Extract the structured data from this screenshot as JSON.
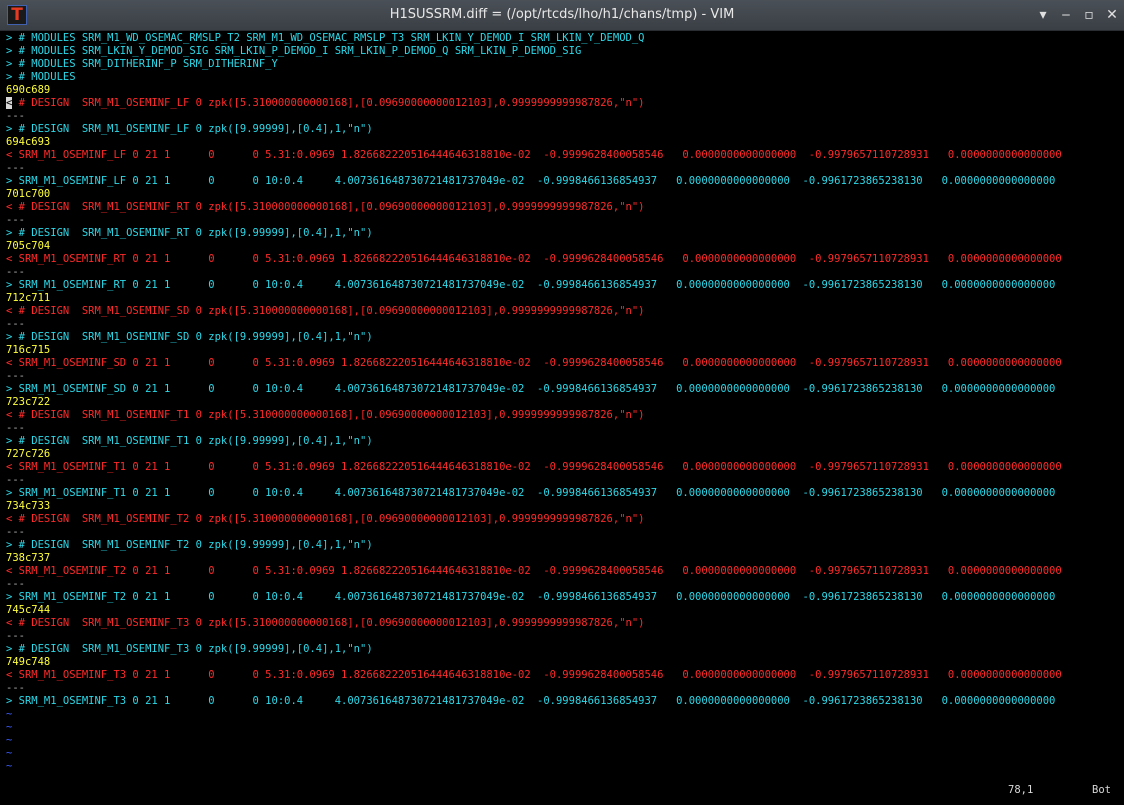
{
  "window": {
    "title": "H1SUSSRM.diff = (/opt/rtcds/lho/h1/chans/tmp) - VIM",
    "icon_glyph": "T",
    "buttons": {
      "shade": "▾",
      "minimize": "‒",
      "maximize": "▫",
      "close": "✕"
    }
  },
  "colors": {
    "added": "#2cd8e8",
    "removed": "#ff2a2a",
    "hunk": "#ffff3c",
    "separator": "#b0b0b0",
    "tilde": "#3a5cff",
    "background": "#000000"
  },
  "lines": [
    {
      "kind": "added",
      "text": "> # MODULES SRM_M1_WD_OSEMAC_RMSLP_T2 SRM_M1_WD_OSEMAC_RMSLP_T3 SRM_LKIN_Y_DEMOD_I SRM_LKIN_Y_DEMOD_Q"
    },
    {
      "kind": "added",
      "text": "> # MODULES SRM_LKIN_Y_DEMOD_SIG SRM_LKIN_P_DEMOD_I SRM_LKIN_P_DEMOD_Q SRM_LKIN_P_DEMOD_SIG"
    },
    {
      "kind": "added",
      "text": "> # MODULES SRM_DITHERINF_P SRM_DITHERINF_Y"
    },
    {
      "kind": "added",
      "text": "> # MODULES"
    },
    {
      "kind": "hunk",
      "text": "690c689"
    },
    {
      "kind": "removed",
      "cursor": "<",
      "text": " # DESIGN  SRM_M1_OSEMINF_LF 0 zpk([5.310000000000168],[0.09690000000012103],0.9999999999987826,\"n\")"
    },
    {
      "kind": "sep",
      "text": "---"
    },
    {
      "kind": "added",
      "text": "> # DESIGN  SRM_M1_OSEMINF_LF 0 zpk([9.99999],[0.4],1,\"n\")"
    },
    {
      "kind": "hunk",
      "text": "694c693"
    },
    {
      "kind": "removed",
      "text": "< SRM_M1_OSEMINF_LF 0 21 1      0      0 5.31:0.0969 1.826682220516444646318810e-02  -0.9999628400058546   0.0000000000000000  -0.9979657110728931   0.0000000000000000"
    },
    {
      "kind": "sep",
      "text": "---"
    },
    {
      "kind": "added",
      "text": "> SRM_M1_OSEMINF_LF 0 21 1      0      0 10:0.4     4.007361648730721481737049e-02  -0.9998466136854937   0.0000000000000000  -0.9961723865238130   0.0000000000000000"
    },
    {
      "kind": "hunk",
      "text": "701c700"
    },
    {
      "kind": "removed",
      "text": "< # DESIGN  SRM_M1_OSEMINF_RT 0 zpk([5.310000000000168],[0.09690000000012103],0.9999999999987826,\"n\")"
    },
    {
      "kind": "sep",
      "text": "---"
    },
    {
      "kind": "added",
      "text": "> # DESIGN  SRM_M1_OSEMINF_RT 0 zpk([9.99999],[0.4],1,\"n\")"
    },
    {
      "kind": "hunk",
      "text": "705c704"
    },
    {
      "kind": "removed",
      "text": "< SRM_M1_OSEMINF_RT 0 21 1      0      0 5.31:0.0969 1.826682220516444646318810e-02  -0.9999628400058546   0.0000000000000000  -0.9979657110728931   0.0000000000000000"
    },
    {
      "kind": "sep",
      "text": "---"
    },
    {
      "kind": "added",
      "text": "> SRM_M1_OSEMINF_RT 0 21 1      0      0 10:0.4     4.007361648730721481737049e-02  -0.9998466136854937   0.0000000000000000  -0.9961723865238130   0.0000000000000000"
    },
    {
      "kind": "hunk",
      "text": "712c711"
    },
    {
      "kind": "removed",
      "text": "< # DESIGN  SRM_M1_OSEMINF_SD 0 zpk([5.310000000000168],[0.09690000000012103],0.9999999999987826,\"n\")"
    },
    {
      "kind": "sep",
      "text": "---"
    },
    {
      "kind": "added",
      "text": "> # DESIGN  SRM_M1_OSEMINF_SD 0 zpk([9.99999],[0.4],1,\"n\")"
    },
    {
      "kind": "hunk",
      "text": "716c715"
    },
    {
      "kind": "removed",
      "text": "< SRM_M1_OSEMINF_SD 0 21 1      0      0 5.31:0.0969 1.826682220516444646318810e-02  -0.9999628400058546   0.0000000000000000  -0.9979657110728931   0.0000000000000000"
    },
    {
      "kind": "sep",
      "text": "---"
    },
    {
      "kind": "added",
      "text": "> SRM_M1_OSEMINF_SD 0 21 1      0      0 10:0.4     4.007361648730721481737049e-02  -0.9998466136854937   0.0000000000000000  -0.9961723865238130   0.0000000000000000"
    },
    {
      "kind": "hunk",
      "text": "723c722"
    },
    {
      "kind": "removed",
      "text": "< # DESIGN  SRM_M1_OSEMINF_T1 0 zpk([5.310000000000168],[0.09690000000012103],0.9999999999987826,\"n\")"
    },
    {
      "kind": "sep",
      "text": "---"
    },
    {
      "kind": "added",
      "text": "> # DESIGN  SRM_M1_OSEMINF_T1 0 zpk([9.99999],[0.4],1,\"n\")"
    },
    {
      "kind": "hunk",
      "text": "727c726"
    },
    {
      "kind": "removed",
      "text": "< SRM_M1_OSEMINF_T1 0 21 1      0      0 5.31:0.0969 1.826682220516444646318810e-02  -0.9999628400058546   0.0000000000000000  -0.9979657110728931   0.0000000000000000"
    },
    {
      "kind": "sep",
      "text": "---"
    },
    {
      "kind": "added",
      "text": "> SRM_M1_OSEMINF_T1 0 21 1      0      0 10:0.4     4.007361648730721481737049e-02  -0.9998466136854937   0.0000000000000000  -0.9961723865238130   0.0000000000000000"
    },
    {
      "kind": "hunk",
      "text": "734c733"
    },
    {
      "kind": "removed",
      "text": "< # DESIGN  SRM_M1_OSEMINF_T2 0 zpk([5.310000000000168],[0.09690000000012103],0.9999999999987826,\"n\")"
    },
    {
      "kind": "sep",
      "text": "---"
    },
    {
      "kind": "added",
      "text": "> # DESIGN  SRM_M1_OSEMINF_T2 0 zpk([9.99999],[0.4],1,\"n\")"
    },
    {
      "kind": "hunk",
      "text": "738c737"
    },
    {
      "kind": "removed",
      "text": "< SRM_M1_OSEMINF_T2 0 21 1      0      0 5.31:0.0969 1.826682220516444646318810e-02  -0.9999628400058546   0.0000000000000000  -0.9979657110728931   0.0000000000000000"
    },
    {
      "kind": "sep",
      "text": "---"
    },
    {
      "kind": "added",
      "text": "> SRM_M1_OSEMINF_T2 0 21 1      0      0 10:0.4     4.007361648730721481737049e-02  -0.9998466136854937   0.0000000000000000  -0.9961723865238130   0.0000000000000000"
    },
    {
      "kind": "hunk",
      "text": "745c744"
    },
    {
      "kind": "removed",
      "text": "< # DESIGN  SRM_M1_OSEMINF_T3 0 zpk([5.310000000000168],[0.09690000000012103],0.9999999999987826,\"n\")"
    },
    {
      "kind": "sep",
      "text": "---"
    },
    {
      "kind": "added",
      "text": "> # DESIGN  SRM_M1_OSEMINF_T3 0 zpk([9.99999],[0.4],1,\"n\")"
    },
    {
      "kind": "hunk",
      "text": "749c748"
    },
    {
      "kind": "removed",
      "text": "< SRM_M1_OSEMINF_T3 0 21 1      0      0 5.31:0.0969 1.826682220516444646318810e-02  -0.9999628400058546   0.0000000000000000  -0.9979657110728931   0.0000000000000000"
    },
    {
      "kind": "sep",
      "text": "---"
    },
    {
      "kind": "added",
      "text": "> SRM_M1_OSEMINF_T3 0 21 1      0      0 10:0.4     4.007361648730721481737049e-02  -0.9998466136854937   0.0000000000000000  -0.9961723865238130   0.0000000000000000"
    },
    {
      "kind": "tilde",
      "text": "~"
    },
    {
      "kind": "tilde",
      "text": "~"
    },
    {
      "kind": "tilde",
      "text": "~"
    },
    {
      "kind": "tilde",
      "text": "~"
    },
    {
      "kind": "tilde",
      "text": "~"
    }
  ],
  "status": {
    "position": "78,1",
    "scroll": "Bot"
  }
}
